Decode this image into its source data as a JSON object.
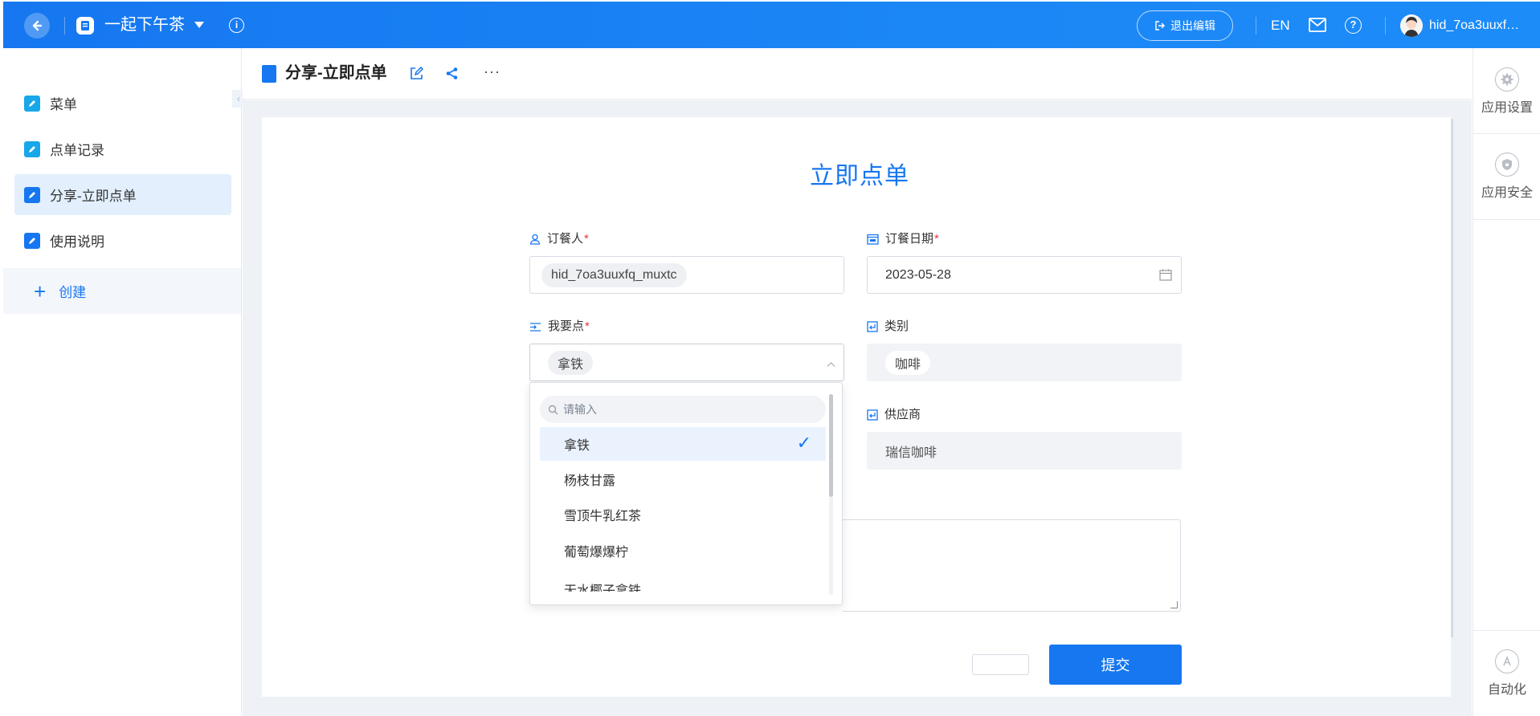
{
  "topbar": {
    "app_name": "一起下午茶",
    "exit_edit_label": "退出编辑",
    "lang_label": "EN",
    "username": "hid_7oa3uuxf…"
  },
  "sidebar": {
    "items": [
      {
        "label": "菜单"
      },
      {
        "label": "点单记录"
      },
      {
        "label": "分享-立即点单"
      },
      {
        "label": "使用说明"
      }
    ],
    "create_label": "创建"
  },
  "page": {
    "title": "分享-立即点单"
  },
  "form": {
    "title": "立即点单",
    "orderer": {
      "label": "订餐人",
      "value": "hid_7oa3uuxfq_muxtc"
    },
    "order_date": {
      "label": "订餐日期",
      "value": "2023-05-28"
    },
    "item": {
      "label": "我要点",
      "value": "拿铁"
    },
    "category": {
      "label": "类别",
      "value": "咖啡"
    },
    "supplier": {
      "label": "供应商",
      "value": "瑞信咖啡"
    },
    "required_mark": "*",
    "submit_label": "提交"
  },
  "dropdown": {
    "search_placeholder": "请输入",
    "options": [
      {
        "label": "拿铁",
        "selected": true
      },
      {
        "label": "杨枝甘露"
      },
      {
        "label": "雪顶牛乳红茶"
      },
      {
        "label": "葡萄爆爆柠"
      },
      {
        "label": "无水椰子拿铁"
      }
    ]
  },
  "right_panel": {
    "app_settings": "应用设置",
    "app_security": "应用安全",
    "automation": "自动化"
  },
  "colors": {
    "brand": "#1677f0",
    "required": "#e8383d"
  }
}
